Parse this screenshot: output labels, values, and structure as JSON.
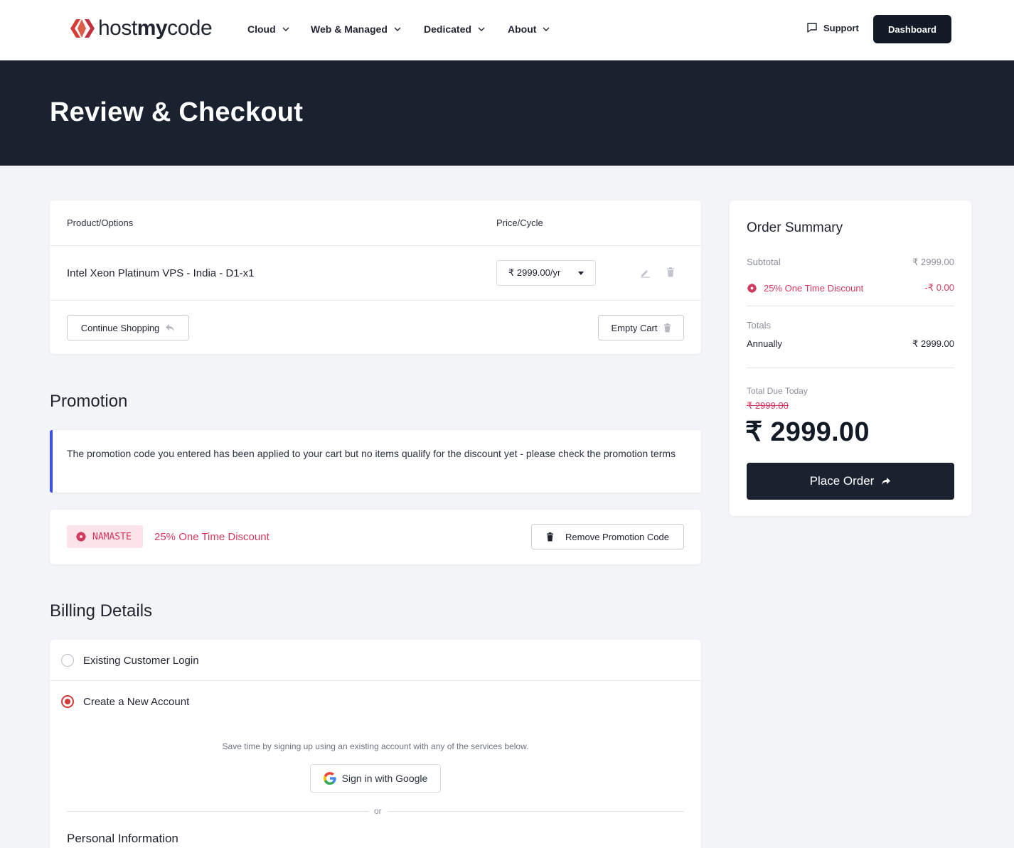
{
  "header": {
    "logo_prefix": "host",
    "logo_bold": "my",
    "logo_suffix": "code",
    "nav": [
      "Cloud",
      "Web & Managed",
      "Dedicated",
      "About"
    ],
    "support_label": "Support",
    "dashboard_label": "Dashboard"
  },
  "hero": {
    "title": "Review & Checkout"
  },
  "cart": {
    "col_product": "Product/Options",
    "col_price": "Price/Cycle",
    "items": [
      {
        "name": "Intel Xeon Platinum VPS - India - D1-x1",
        "price": "₹ 2999.00/yr"
      }
    ],
    "continue_label": "Continue Shopping",
    "empty_label": "Empty Cart"
  },
  "promotion": {
    "title": "Promotion",
    "notice": "The promotion code you entered has been applied to your cart but no items qualify for the discount yet - please check the promotion terms",
    "code": "NAMASTE",
    "description": "25% One Time Discount",
    "remove_label": "Remove Promotion Code"
  },
  "billing": {
    "title": "Billing Details",
    "options": [
      {
        "label": "Existing Customer Login",
        "selected": false
      },
      {
        "label": "Create a New Account",
        "selected": true
      }
    ],
    "save_time_text": "Save time by signing up using an existing account with any of the services below.",
    "google_label": "Sign in with Google",
    "or_text": "or",
    "personal_title": "Personal Information"
  },
  "summary": {
    "title": "Order Summary",
    "subtotal_label": "Subtotal",
    "subtotal_value": "₹ 2999.00",
    "discount_label": "25% One Time Discount",
    "discount_value": "-₹ 0.00",
    "totals_label": "Totals",
    "cycle_label": "Annually",
    "cycle_value": "₹ 2999.00",
    "due_label": "Total Due Today",
    "original_total": "₹ 2999.00",
    "total_due": "₹ 2999.00",
    "place_order_label": "Place Order"
  },
  "colors": {
    "dark": "#1a2230",
    "accent_pink": "#d2395e",
    "alert_border": "#3a53d6",
    "radio_red": "#d03a3a"
  }
}
